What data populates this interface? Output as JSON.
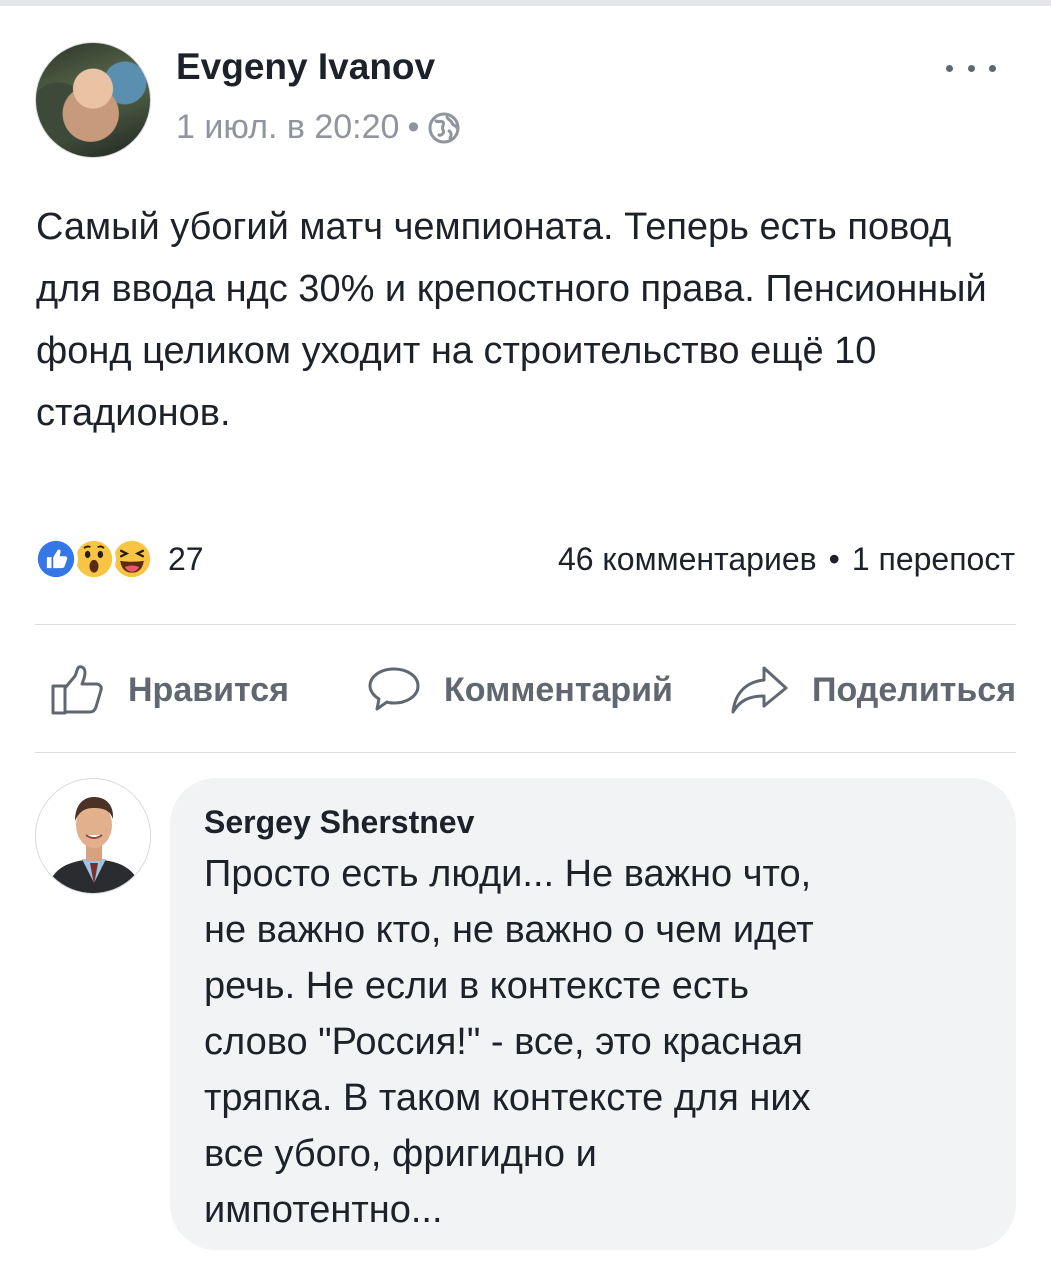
{
  "post": {
    "author": "Evgeny Ivanov",
    "timestamp": "1 июл. в 20:20",
    "meta_separator": "•",
    "privacy_icon": "globe-icon",
    "more_icon": "more-options-icon",
    "text": "Самый убогий матч чемпионата. Теперь есть повод для ввода ндс 30% и крепостного права. Пенсионный фонд целиком уходит на строительство ещё 10 стадионов."
  },
  "reactions": {
    "types": [
      "like",
      "wow",
      "haha"
    ],
    "count": "27",
    "comments": "46 комментариев",
    "separator": "•",
    "shares": "1 перепост"
  },
  "actions": {
    "like_label": "Нравится",
    "comment_label": "Комментарий",
    "share_label": "Поделиться"
  },
  "comment": {
    "author": "Sergey Sherstnev",
    "text": "Просто есть люди...  Не важно что,\nне важно кто,  не важно о чем идет\nречь.  Не если в контексте есть\nслово \"Россия!\" - все,  это красная\nтряпка.  В таком контексте для них\nвсе убого,  фригидно и\nимпотентно..."
  },
  "colors": {
    "text_primary": "#1d2129",
    "text_secondary": "#90949c",
    "action_gray": "#606770",
    "like_blue": "#3578e5",
    "emoji_yellow": "#f7c543",
    "bubble_bg": "#f2f3f5",
    "divider": "#dadde1"
  }
}
